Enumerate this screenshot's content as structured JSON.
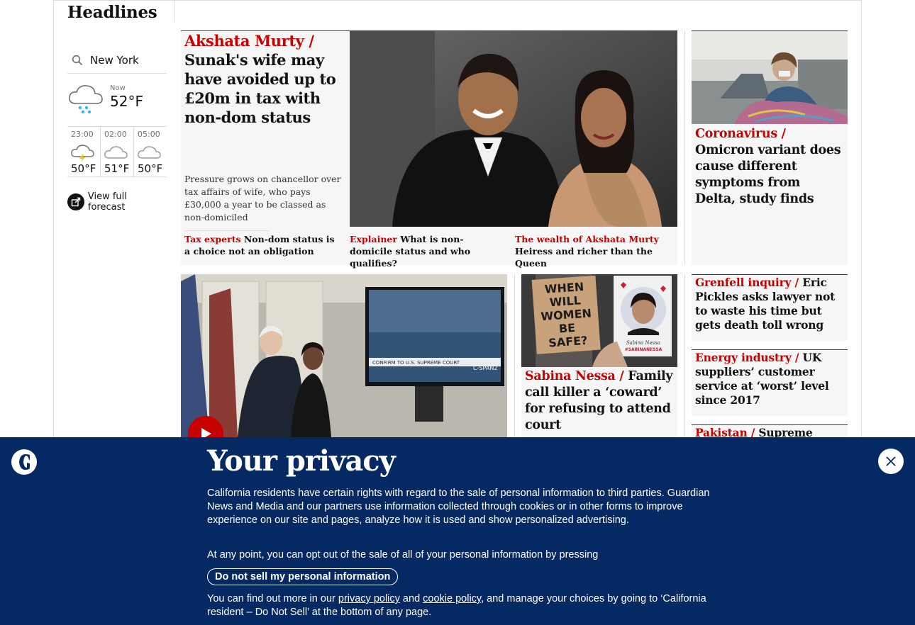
{
  "section": {
    "title": "Headlines"
  },
  "weather": {
    "location": "New York",
    "now_label": "Now",
    "now_temp": "52°F",
    "hourly": [
      {
        "time": "23:00",
        "temp": "50°F",
        "icon": "thunder-rain-icon"
      },
      {
        "time": "02:00",
        "temp": "51°F",
        "icon": "cloud-icon"
      },
      {
        "time": "05:00",
        "temp": "50°F",
        "icon": "cloud-icon"
      }
    ],
    "forecast_link": "View full forecast"
  },
  "main_story": {
    "kicker": "Akshata Murty /",
    "headline": "Sunak's wife may have avoided up to £20m in tax with non-dom status",
    "standfirst": "Pressure grows on chancellor over tax affairs of wife, who pays £30,000 a year to be classed as non-domiciled",
    "sublinks": [
      {
        "kicker": "Tax experts",
        "text": "Non-dom status is a choice not an obligation"
      },
      {
        "kicker": "Explainer",
        "text": "What is non-domicile status and who qualifies?"
      },
      {
        "kicker": "The wealth of Akshata Murty",
        "text": "Heiress and richer than the Queen"
      }
    ]
  },
  "right_story": {
    "kicker": "Coronavirus /",
    "headline": "Omicron variant does cause different symptoms from Delta, study finds"
  },
  "mid_story": {
    "kicker": "Sabina Nessa  /",
    "headline": "Family call killer a ‘coward’ for refusing to attend court",
    "sign_text": "WHEN WILL WOMEN BE SAFE?",
    "placard_caption": "Sabina Nessa",
    "placard_label": "#SABINANESSA"
  },
  "video_story": {
    "screen_caption": "C-SPAN2",
    "screen_label": "CONFIRM TO U.S. SUPREME COURT"
  },
  "small_stories": [
    {
      "kicker": "Grenfell inquiry /",
      "headline": "Eric Pickles asks lawyer not to waste his time but gets death toll wrong"
    },
    {
      "kicker": "Energy industry /",
      "headline": "UK suppliers’ customer service at ‘worst’ level since 2017"
    },
    {
      "kicker": "Pakistan /",
      "headline": "Supreme court"
    }
  ],
  "privacy": {
    "title": "Your privacy",
    "para1": "California residents have certain rights with regard to the sale of personal information to third parties. Guardian News and Media and our partners use information collected through cookies or in other forms to improve experience on our site and pages, analyze how it is used and show personalized advertising.",
    "para2": "At any point, you can opt out of the sale of all of your personal information by pressing",
    "optout_button": "Do not sell my personal information",
    "para3_before": "You can find out more in our ",
    "privacy_link": "privacy policy",
    "para3_mid": " and ",
    "cookie_link": "cookie policy",
    "para3_after": ", and manage your choices by going to ‘California resident – Do Not Sell’ at the bottom of any page."
  },
  "colors": {
    "brand_red": "#c70000",
    "banner_blue": "#052962"
  }
}
